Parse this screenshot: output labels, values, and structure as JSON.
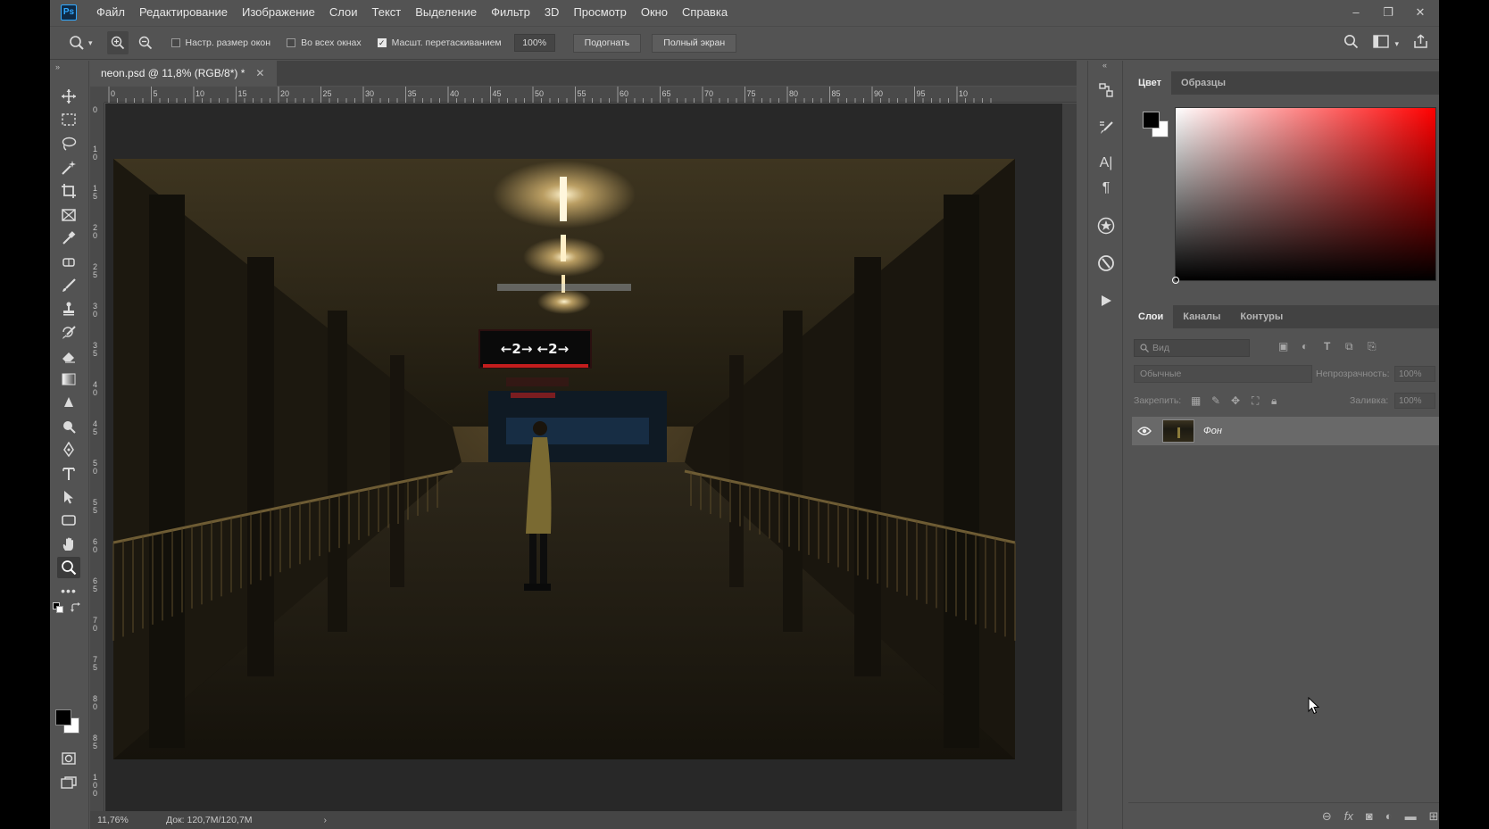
{
  "app": {
    "logo": "Ps"
  },
  "menu": [
    "Файл",
    "Редактирование",
    "Изображение",
    "Слои",
    "Текст",
    "Выделение",
    "Фильтр",
    "3D",
    "Просмотр",
    "Окно",
    "Справка"
  ],
  "window_controls": {
    "minimize": "‒",
    "restore": "❐",
    "close": "✕"
  },
  "options": {
    "resize_windows": {
      "label": "Настр. размер окон",
      "checked": false
    },
    "all_windows": {
      "label": "Во всех окнах",
      "checked": false
    },
    "scrubby_zoom": {
      "label": "Масшт. перетаскиванием",
      "checked": true
    },
    "zoom_value": "100%",
    "fit_button": "Подогнать",
    "fill_screen_button": "Полный экран"
  },
  "document": {
    "tab_title": "neon.psd @ 11,8% (RGB/8*) *",
    "ruler_top": [
      "0",
      "5",
      "10",
      "15",
      "20",
      "25",
      "30",
      "35",
      "40",
      "45",
      "50",
      "55",
      "60",
      "65",
      "70",
      "75",
      "80",
      "85",
      "90",
      "95",
      "10"
    ],
    "ruler_left": [
      "0",
      "1\n0",
      "1\n5",
      "2\n0",
      "2\n5",
      "3\n0",
      "3\n5",
      "4\n0",
      "4\n5",
      "5\n0",
      "5\n5",
      "6\n0",
      "6\n5",
      "7\n0",
      "7\n5",
      "8\n0",
      "8\n5",
      "1\n0\n0"
    ],
    "sign_text": "←2→ ←2→",
    "status_zoom": "11,76%",
    "status_info": "Док: 120,7M/120,7M"
  },
  "color_panel": {
    "tabs": [
      "Цвет",
      "Образцы"
    ],
    "active_tab": "Цвет",
    "hue": "#ff0000"
  },
  "layers_panel": {
    "tabs": [
      "Слои",
      "Каналы",
      "Контуры"
    ],
    "active_tab": "Слои",
    "search_placeholder": "Вид",
    "blend_mode": "Обычные",
    "opacity_label": "Непрозрачность:",
    "opacity_value": "100%",
    "lock_label": "Закрепить:",
    "fill_label": "Заливка:",
    "fill_value": "100%",
    "layers": [
      {
        "name": "Фон",
        "visible": true,
        "locked": true
      }
    ]
  }
}
